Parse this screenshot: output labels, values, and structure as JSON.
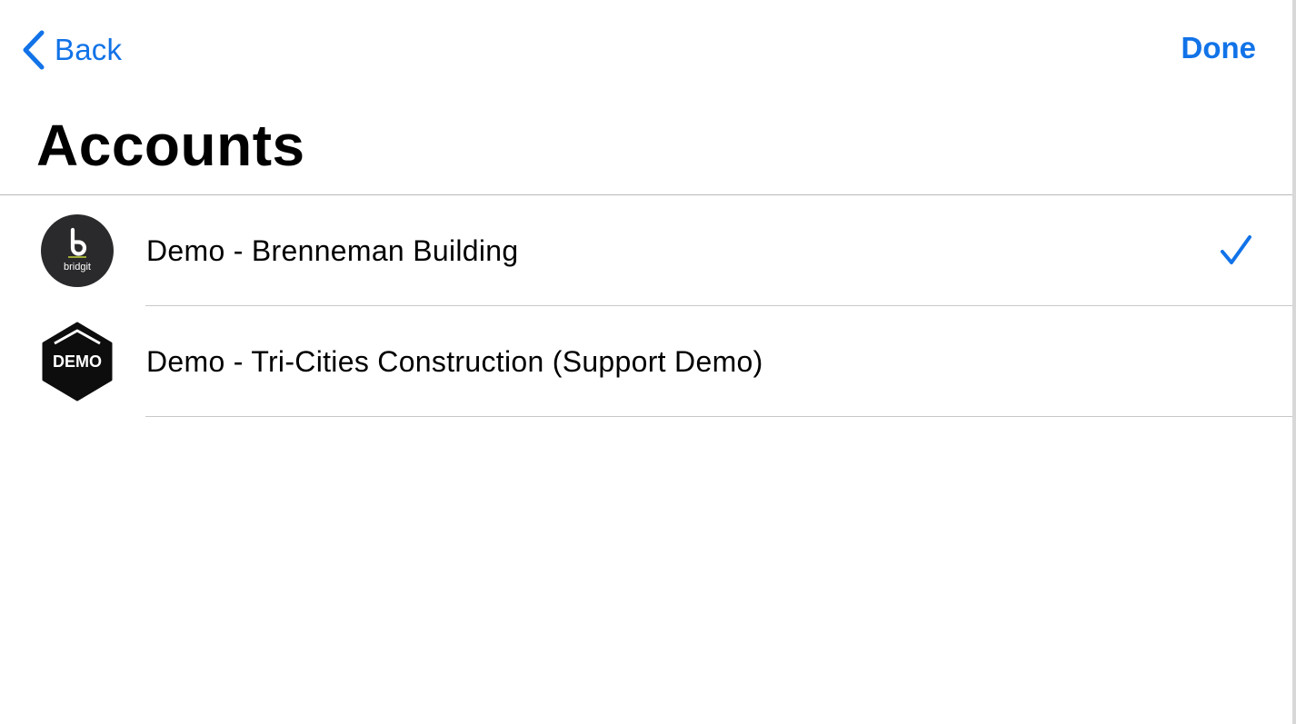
{
  "nav": {
    "back_label": "Back",
    "done_label": "Done"
  },
  "page": {
    "title": "Accounts"
  },
  "accounts": [
    {
      "label": "Demo - Brenneman Building",
      "logo_text": "bridgit",
      "logo_icon": "bridgit-logo-icon",
      "selected": true
    },
    {
      "label": "Demo - Tri-Cities Construction (Support Demo)",
      "logo_text": "DEMO",
      "logo_icon": "demo-logo-icon",
      "selected": false
    }
  ],
  "colors": {
    "accent": "#1273e8",
    "separator": "#c8c8cc",
    "logo_dark": "#2a2a2c"
  }
}
